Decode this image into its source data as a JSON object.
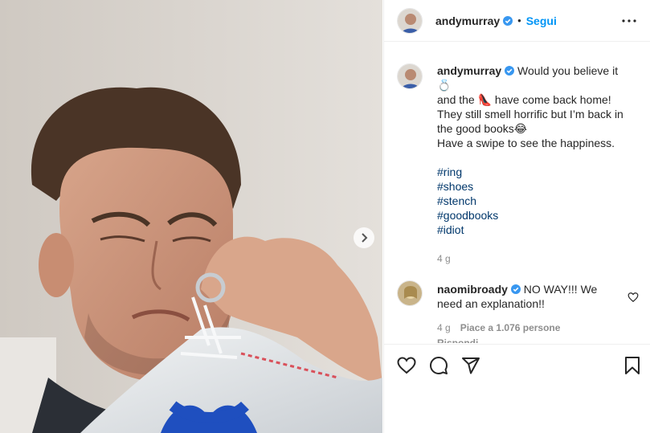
{
  "post": {
    "username": "andymurray",
    "follow_label": "Segui",
    "dot": "•"
  },
  "caption": {
    "username": "andymurray",
    "line1": "Would you believe it 💍",
    "line2": "and the 👠 have come back home!",
    "line3": "They still smell horrific but I’m back in",
    "line4": "the good books😂",
    "line5": "Have a swipe to see the happiness.",
    "tags": [
      "#ring",
      "#shoes",
      "#stench",
      "#goodbooks",
      "#idiot"
    ],
    "time": "4 g"
  },
  "comment": {
    "username": "naomibroady",
    "text": "NO WAY!!! We need an explanation!!",
    "time": "4 g",
    "likes": "Piace a 1.076 persone",
    "reply": "Rispondi"
  },
  "icons": {
    "verified": "verified-badge-icon",
    "more": "more-options-icon",
    "next": "chevron-right-icon",
    "like": "heart-icon",
    "comment": "comment-icon",
    "share": "send-icon",
    "save": "bookmark-icon"
  },
  "colors": {
    "link": "#0095f6",
    "hashtag": "#00376b",
    "meta": "#8e8e8e",
    "verified": "#3897f0"
  }
}
